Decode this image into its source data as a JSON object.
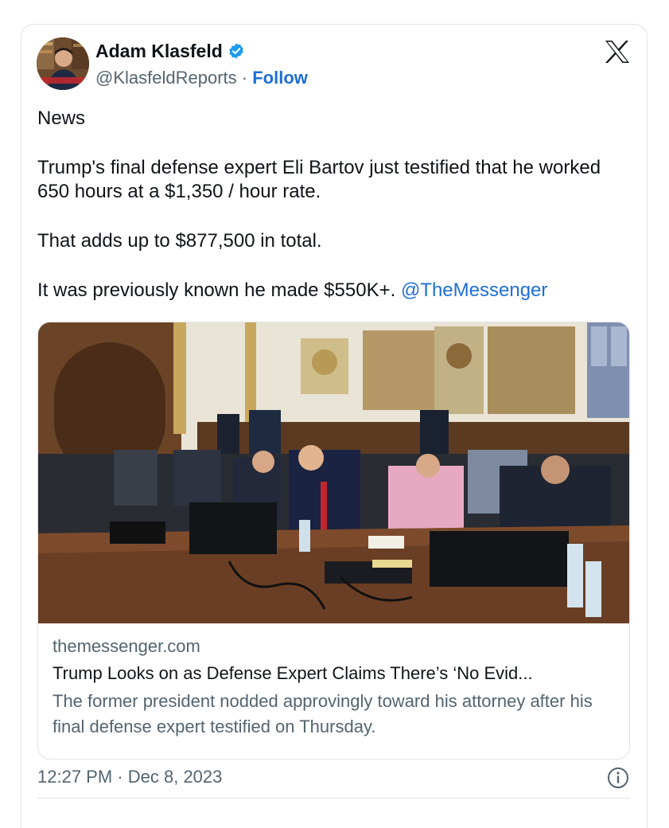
{
  "author": {
    "name": "Adam Klasfeld",
    "handle": "@KlasfeldReports",
    "separator": "·",
    "follow_label": "Follow",
    "verified_color": "#1d9bf0"
  },
  "brand": {
    "logo_icon": "x-logo-icon"
  },
  "tweet": {
    "lines": [
      "News",
      "Trump's final defense expert Eli Bartov just testified that he worked 650 hours at a $1,350 / hour rate.",
      "That adds up to $877,500 in total.",
      "It was previously known he made $550K+."
    ],
    "mention": "@TheMessenger"
  },
  "link_card": {
    "domain": "themessenger.com",
    "headline": "Trump Looks on as Defense Expert Claims There’s ‘No Evid...",
    "description": "The former president nodded approvingly toward his attorney after his final defense expert testified on Thursday."
  },
  "footer": {
    "time": "12:27 PM",
    "separator": "·",
    "date": "Dec 8, 2023",
    "info_icon": "info-icon"
  },
  "colors": {
    "link": "#1d6fd8",
    "muted": "#536471",
    "text": "#0f1419",
    "border": "#dfe3e6"
  }
}
